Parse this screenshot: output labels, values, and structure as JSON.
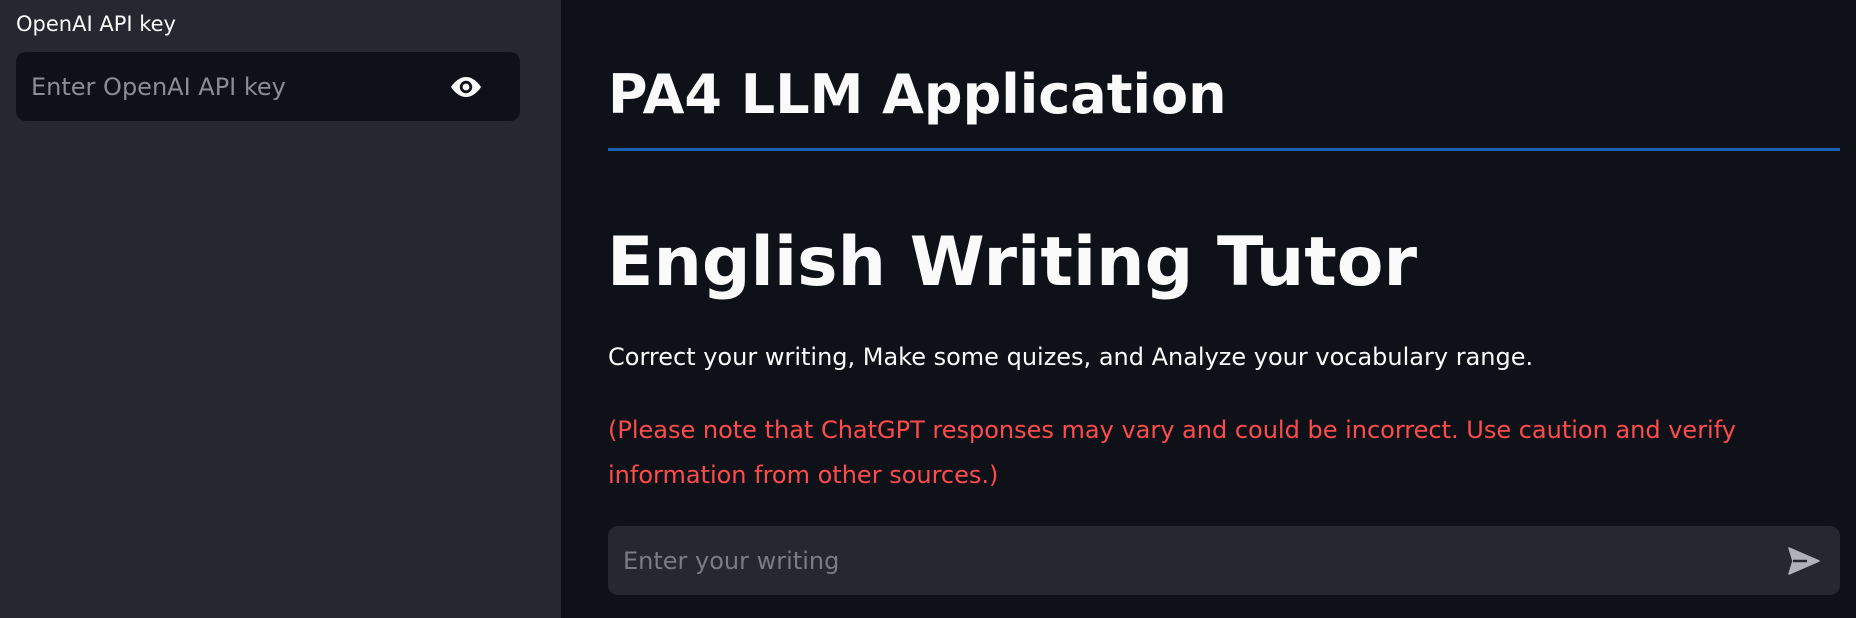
{
  "sidebar": {
    "api_key_label": "OpenAI API key",
    "api_key_placeholder": "Enter OpenAI API key",
    "api_key_value": "",
    "toggle_icon": "eye-icon"
  },
  "main": {
    "app_title": "PA4 LLM Application",
    "heading": "English Writing Tutor",
    "description": "Correct your writing, Make some quizes, and Analyze your vocabulary range.",
    "warning": "(Please note that ChatGPT responses may vary and could be incorrect. Use caution and verify information from other sources.)",
    "chat_placeholder": "Enter your writing",
    "send_icon": "send-icon"
  },
  "colors": {
    "sidebar_bg": "#262730",
    "main_bg": "#0e1117",
    "divider": "#1c5eb0",
    "warning_text": "#ff4b4b",
    "text": "#fafafa"
  }
}
